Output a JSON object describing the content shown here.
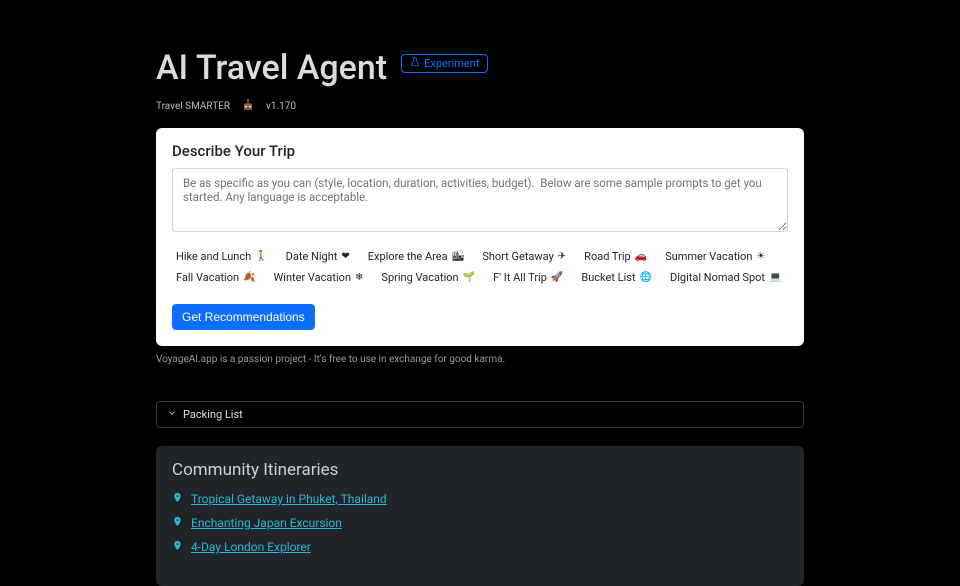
{
  "header": {
    "title": "AI Travel Agent",
    "badge_label": "Experiment",
    "slogan": "Travel SMARTER",
    "version": "v1.170"
  },
  "describe": {
    "heading": "Describe Your Trip",
    "placeholder": "Be as specific as you can (style, location, duration, activities, budget).  Below are some sample prompts to get you started. Any language is acceptable.",
    "value": ""
  },
  "chips": [
    {
      "label": "Hike and Lunch",
      "icon": "hiker-icon",
      "glyph": "🚶"
    },
    {
      "label": "Date Night",
      "icon": "heart-icon",
      "glyph": "❤"
    },
    {
      "label": "Explore the Area",
      "icon": "city-icon",
      "glyph": "🏙"
    },
    {
      "label": "Short Getaway",
      "icon": "plane-icon",
      "glyph": "✈"
    },
    {
      "label": "Road Trip",
      "icon": "car-icon",
      "glyph": "🚗"
    },
    {
      "label": "Summer Vacation",
      "icon": "sun-icon",
      "glyph": "☀"
    },
    {
      "label": "Fall Vacation",
      "icon": "leaf-icon",
      "glyph": "🍂"
    },
    {
      "label": "Winter Vacation",
      "icon": "snowflake-icon",
      "glyph": "❄"
    },
    {
      "label": "Spring Vacation",
      "icon": "seedling-icon",
      "glyph": "🌱"
    },
    {
      "label": "F' It All Trip",
      "icon": "rocket-icon",
      "glyph": "🚀"
    },
    {
      "label": "Bucket List",
      "icon": "globe-icon",
      "glyph": "🌐"
    },
    {
      "label": "Digital Nomad Spot",
      "icon": "laptop-icon",
      "glyph": "💻"
    }
  ],
  "actions": {
    "get_recommendations": "Get Recommendations"
  },
  "disclaimer": "VoyageAI.app is a passion project - It's free to use in exchange for good karma.",
  "accordion": {
    "packing_list": "Packing List"
  },
  "community": {
    "heading": "Community Itineraries",
    "items": [
      "Tropical Getaway in Phuket, Thailand",
      "Enchanting Japan Excursion",
      "4-Day London Explorer"
    ]
  }
}
